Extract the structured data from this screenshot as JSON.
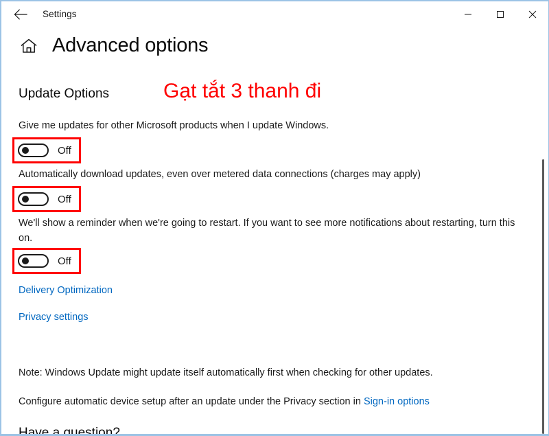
{
  "window": {
    "title": "Settings",
    "back_icon": "back-arrow-icon",
    "controls": {
      "minimize": "minimize-icon",
      "maximize": "maximize-icon",
      "close": "close-icon"
    }
  },
  "page": {
    "home_icon": "home-icon",
    "title": "Advanced options"
  },
  "section": {
    "heading": "Update Options"
  },
  "annotation": {
    "text": "Gạt tắt 3 thanh đi",
    "color": "#ff0000"
  },
  "settings": [
    {
      "label": "Give me updates for other Microsoft products when I update Windows.",
      "toggle_state": "Off",
      "highlighted": true
    },
    {
      "label": "Automatically download updates, even over metered data connections (charges may apply)",
      "toggle_state": "Off",
      "highlighted": true
    },
    {
      "label": "We'll show a reminder when we're going to restart. If you want to see more notifications about restarting, turn this on.",
      "toggle_state": "Off",
      "highlighted": true
    }
  ],
  "links": [
    {
      "label": "Delivery Optimization"
    },
    {
      "label": "Privacy settings"
    }
  ],
  "notes": {
    "note_line": "Note: Windows Update might update itself automatically first when checking for other updates.",
    "configure_prefix": "Configure automatic device setup after an update under the Privacy section in ",
    "configure_link": "Sign-in options"
  },
  "cut_off": {
    "heading": "Have a question?"
  },
  "colors": {
    "link": "#0067c0",
    "text": "#1b1b1b",
    "accent_red": "#ff0000",
    "window_border": "#9cc3e5"
  }
}
